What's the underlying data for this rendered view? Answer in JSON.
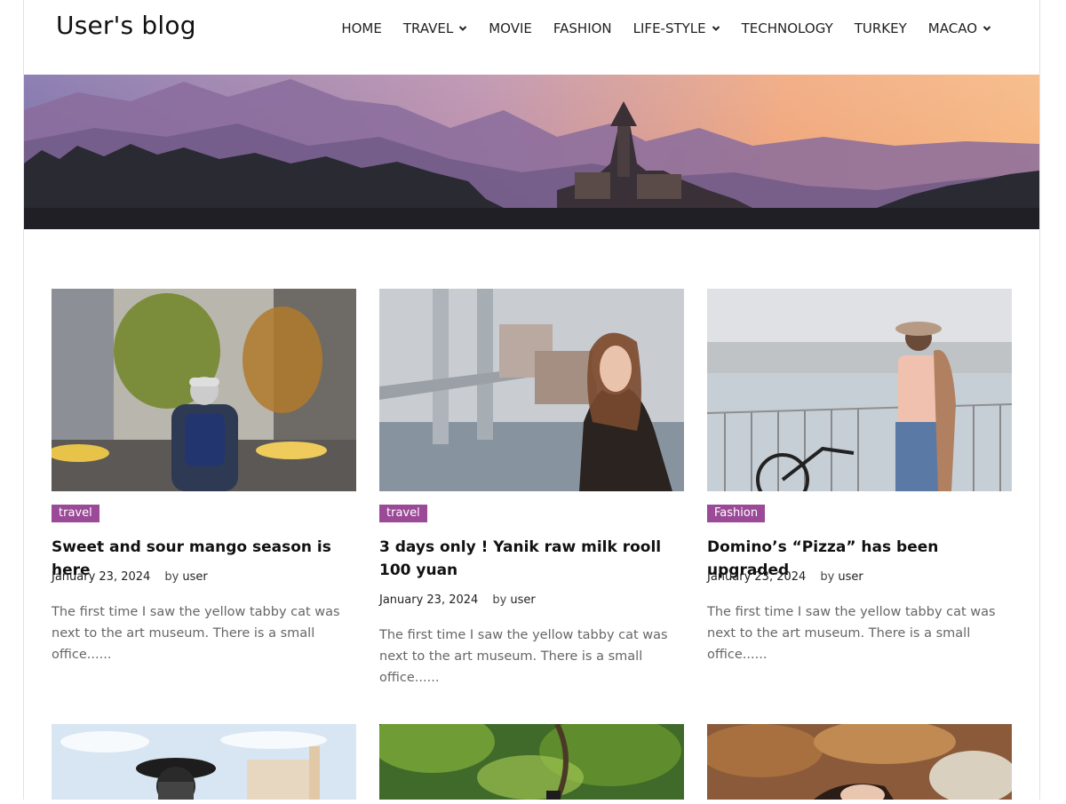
{
  "site": {
    "logo": "User's blog"
  },
  "nav": {
    "items": [
      {
        "label": "HOME",
        "dropdown": false
      },
      {
        "label": "TRAVEL",
        "dropdown": true
      },
      {
        "label": "MOVIE",
        "dropdown": false
      },
      {
        "label": "FASHION",
        "dropdown": false
      },
      {
        "label": "LIFE-STYLE",
        "dropdown": true
      },
      {
        "label": "TECHNOLOGY",
        "dropdown": false
      },
      {
        "label": "TURKEY",
        "dropdown": false
      },
      {
        "label": "MACAO",
        "dropdown": true
      }
    ]
  },
  "posts": [
    {
      "tag": "travel",
      "title": "Sweet and sour mango season is here",
      "date": "January 23, 2024",
      "by": "by",
      "author": "user",
      "excerpt": "The first time I saw the yellow tabby cat was next to the art museum. There is a small office......"
    },
    {
      "tag": "travel",
      "title": "3 days only ! Yanik raw milk rooll 100 yuan",
      "date": "January 23, 2024",
      "by": "by",
      "author": "user",
      "excerpt": "The first time I saw the yellow tabby cat was next to the art museum. There is a small office......"
    },
    {
      "tag": "Fashion",
      "title": "Domino’s “Pizza” has been upgraded",
      "date": "January 23, 2024",
      "by": "by",
      "author": "user",
      "excerpt": "The first time I saw the yellow tabby cat was next to the art museum. There is a small office......"
    }
  ],
  "colors": {
    "tag_bg": "#9b4a97"
  }
}
